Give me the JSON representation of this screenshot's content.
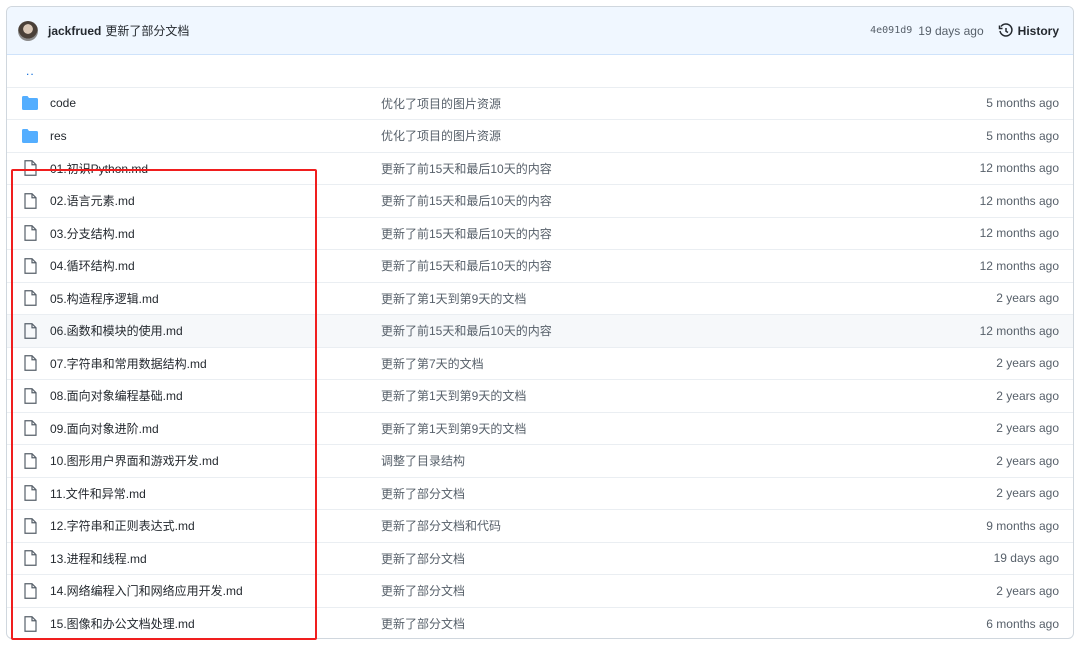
{
  "header": {
    "author": "jackfrued",
    "message": "更新了部分文档",
    "sha": "4e091d9",
    "time": "19 days ago",
    "history_label": "History"
  },
  "parent_link": "..",
  "files": [
    {
      "type": "folder",
      "name": "code",
      "commit": "优化了项目的图片资源",
      "age": "5 months ago"
    },
    {
      "type": "folder",
      "name": "res",
      "commit": "优化了项目的图片资源",
      "age": "5 months ago"
    },
    {
      "type": "file",
      "name": "01.初识Python.md",
      "commit": "更新了前15天和最后10天的内容",
      "age": "12 months ago"
    },
    {
      "type": "file",
      "name": "02.语言元素.md",
      "commit": "更新了前15天和最后10天的内容",
      "age": "12 months ago"
    },
    {
      "type": "file",
      "name": "03.分支结构.md",
      "commit": "更新了前15天和最后10天的内容",
      "age": "12 months ago"
    },
    {
      "type": "file",
      "name": "04.循环结构.md",
      "commit": "更新了前15天和最后10天的内容",
      "age": "12 months ago"
    },
    {
      "type": "file",
      "name": "05.构造程序逻辑.md",
      "commit": "更新了第1天到第9天的文档",
      "age": "2 years ago"
    },
    {
      "type": "file",
      "name": "06.函数和模块的使用.md",
      "commit": "更新了前15天和最后10天的内容",
      "age": "12 months ago",
      "hover": true
    },
    {
      "type": "file",
      "name": "07.字符串和常用数据结构.md",
      "commit": "更新了第7天的文档",
      "age": "2 years ago"
    },
    {
      "type": "file",
      "name": "08.面向对象编程基础.md",
      "commit": "更新了第1天到第9天的文档",
      "age": "2 years ago"
    },
    {
      "type": "file",
      "name": "09.面向对象进阶.md",
      "commit": "更新了第1天到第9天的文档",
      "age": "2 years ago"
    },
    {
      "type": "file",
      "name": "10.图形用户界面和游戏开发.md",
      "commit": "调整了目录结构",
      "age": "2 years ago"
    },
    {
      "type": "file",
      "name": "11.文件和异常.md",
      "commit": "更新了部分文档",
      "age": "2 years ago"
    },
    {
      "type": "file",
      "name": "12.字符串和正则表达式.md",
      "commit": "更新了部分文档和代码",
      "age": "9 months ago"
    },
    {
      "type": "file",
      "name": "13.进程和线程.md",
      "commit": "更新了部分文档",
      "age": "19 days ago"
    },
    {
      "type": "file",
      "name": "14.网络编程入门和网络应用开发.md",
      "commit": "更新了部分文档",
      "age": "2 years ago"
    },
    {
      "type": "file",
      "name": "15.图像和办公文档处理.md",
      "commit": "更新了部分文档",
      "age": "6 months ago"
    }
  ],
  "colors": {
    "folder": "#54aeff",
    "annotation": "#f01e1e",
    "header_bg": "#f0f7ff"
  }
}
